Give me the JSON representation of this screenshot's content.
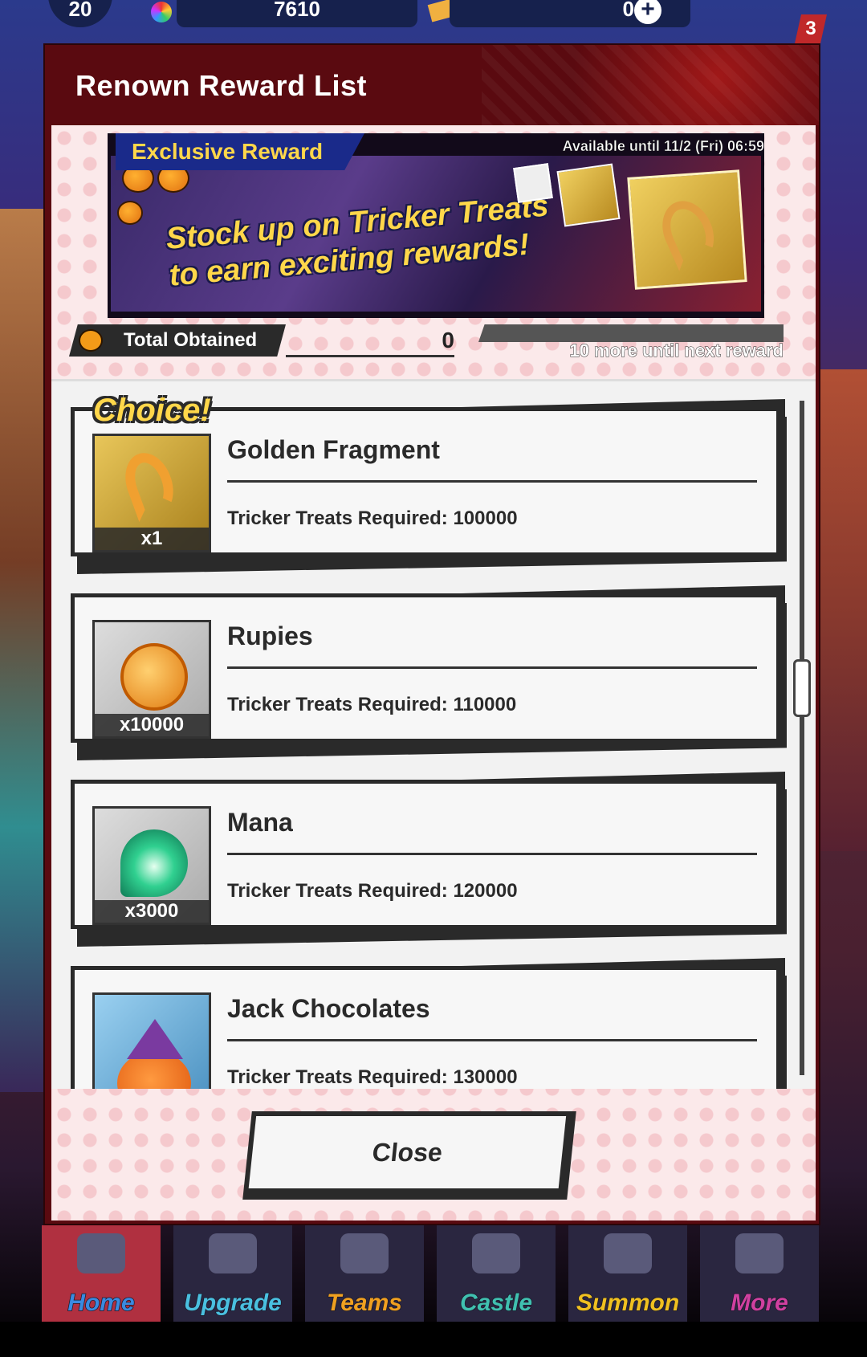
{
  "topbar": {
    "level": "20",
    "gems": "7610",
    "tickets": "0",
    "plus_label": "+",
    "notification_count": "3"
  },
  "modal": {
    "title": "Renown Reward List"
  },
  "banner": {
    "tag": "Exclusive Reward",
    "available_until": "Available until 11/2 (Fri) 06:59",
    "headline_line1": "Stock up on Tricker Treats",
    "headline_line2": "to earn exciting rewards!"
  },
  "stats": {
    "label": "Total Obtained",
    "total": "0",
    "next_reward": "10 more until next reward",
    "progress_fraction": 0
  },
  "rewards": [
    {
      "badge": "Choice!",
      "name": "Golden Fragment",
      "quantity": "x1",
      "requirement": "Tricker Treats Required: 100000",
      "icon": "golden-fragment-icon"
    },
    {
      "name": "Rupies",
      "quantity": "x10000",
      "requirement": "Tricker Treats Required: 110000",
      "icon": "rupie-coin-icon"
    },
    {
      "name": "Mana",
      "quantity": "x3000",
      "requirement": "Tricker Treats Required: 120000",
      "icon": "mana-orb-icon"
    },
    {
      "name": "Jack Chocolates",
      "quantity": "",
      "requirement": "Tricker Treats Required: 130000",
      "icon": "jack-chocolates-icon"
    }
  ],
  "buttons": {
    "close": "Close"
  },
  "nav": [
    {
      "label": "Home",
      "color": "#3a8ae0"
    },
    {
      "label": "Upgrade",
      "color": "#4ac0e0"
    },
    {
      "label": "Teams",
      "color": "#f0a020"
    },
    {
      "label": "Castle",
      "color": "#40c0b0"
    },
    {
      "label": "Summon",
      "color": "#f0c020"
    },
    {
      "label": "More",
      "color": "#d040a0"
    }
  ]
}
